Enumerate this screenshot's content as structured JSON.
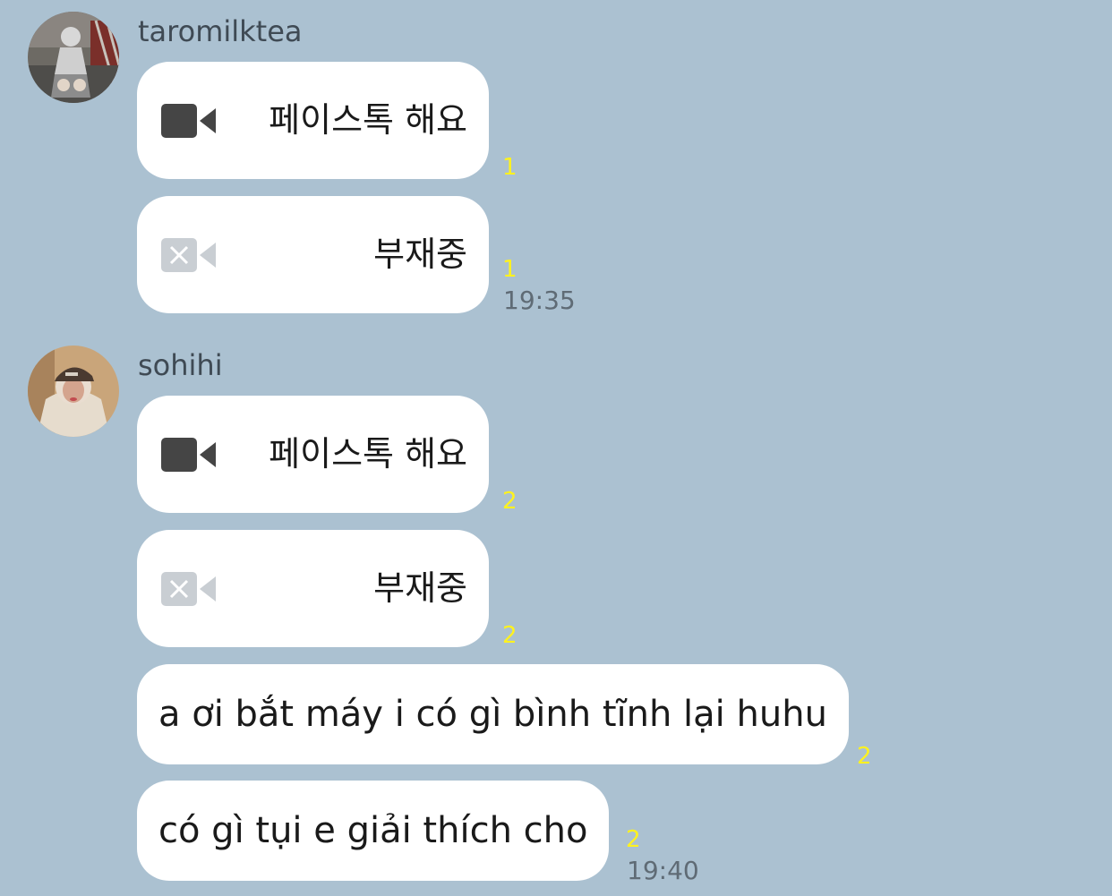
{
  "colors": {
    "background": "#abc1d1",
    "bubble": "#ffffff",
    "unread": "#fff21f",
    "time": "#5f6b75"
  },
  "groups": [
    {
      "sender": "taromilktea",
      "avatar_icon": "profile-photo",
      "messages": [
        {
          "type": "video-call",
          "icon": "video-camera-icon",
          "label": "페이스톡 해요",
          "unread": "1"
        },
        {
          "type": "missed-call",
          "icon": "video-camera-missed-icon",
          "label": "부재중",
          "unread": "1"
        }
      ],
      "time": "19:35"
    },
    {
      "sender": "sohihi",
      "avatar_icon": "profile-photo",
      "messages": [
        {
          "type": "video-call",
          "icon": "video-camera-icon",
          "label": "페이스톡 해요",
          "unread": "2"
        },
        {
          "type": "missed-call",
          "icon": "video-camera-missed-icon",
          "label": "부재중",
          "unread": "2"
        },
        {
          "type": "text",
          "text": "a ơi bắt máy i có gì bình tĩnh lại huhu",
          "unread": "2"
        },
        {
          "type": "text",
          "text": "có gì tụi e giải thích cho",
          "unread": "2"
        }
      ],
      "time": "19:40"
    }
  ]
}
